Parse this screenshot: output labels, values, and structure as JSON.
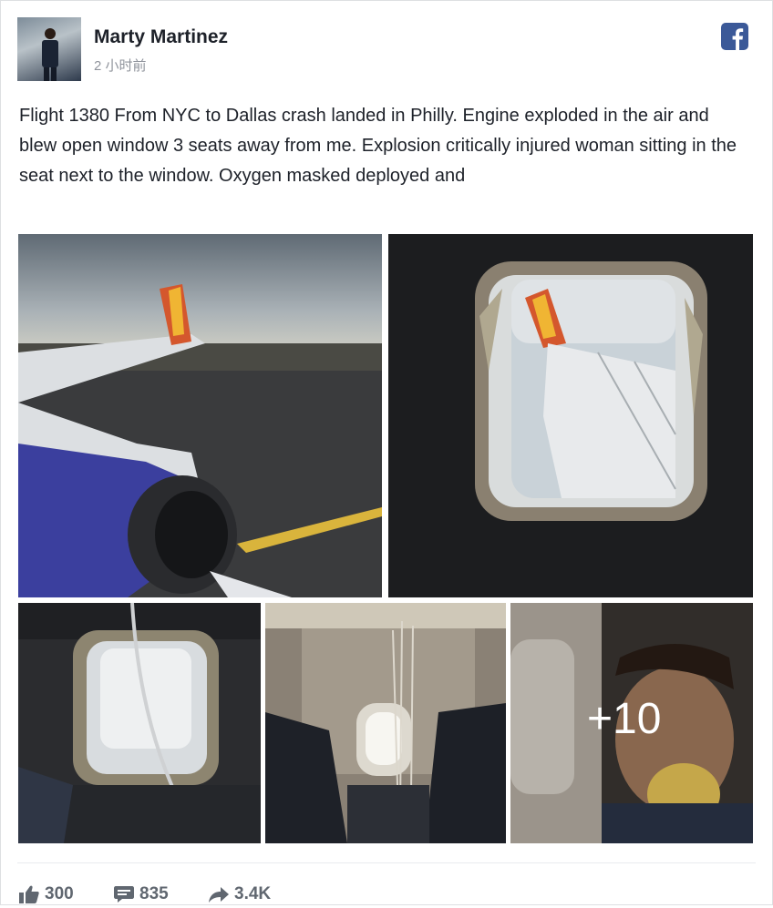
{
  "post": {
    "author_name": "Marty Martinez",
    "timestamp": "2 小时前",
    "text": "Flight 1380 From NYC to Dallas crash landed in Philly. Engine exploded in the air and blew open window 3 seats away from me. Explosion critically injured woman sitting in the seat next to the window. Oxygen masked deployed and",
    "more_photos_label": "+10"
  },
  "stats": {
    "likes": "300",
    "comments": "835",
    "shares": "3.4K"
  },
  "icons": {
    "brand": "facebook-icon",
    "like": "thumbs-up-icon",
    "comment": "comment-icon",
    "share": "share-arrow-icon"
  },
  "colors": {
    "facebook_blue": "#3b5998",
    "meta_gray": "#90949c",
    "stat_gray": "#606770"
  }
}
